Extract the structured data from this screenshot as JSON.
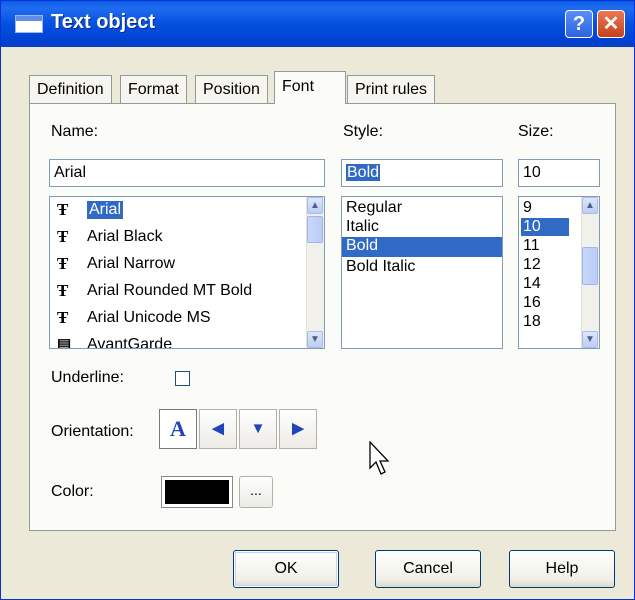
{
  "window": {
    "title": "Text object",
    "help_glyph": "?",
    "close_glyph": "✕"
  },
  "tabs": [
    {
      "label": "Definition"
    },
    {
      "label": "Format"
    },
    {
      "label": "Position"
    },
    {
      "label": "Font"
    },
    {
      "label": "Print rules"
    }
  ],
  "active_tab": "Font",
  "name": {
    "label": "Name:",
    "value": "Arial",
    "fonts": [
      {
        "label": "Arial",
        "icon": "truetype-icon",
        "selected": true
      },
      {
        "label": "Arial Black",
        "icon": "truetype-icon"
      },
      {
        "label": "Arial Narrow",
        "icon": "truetype-icon"
      },
      {
        "label": "Arial Rounded MT Bold",
        "icon": "truetype-icon"
      },
      {
        "label": "Arial Unicode MS",
        "icon": "truetype-icon"
      },
      {
        "label": "AvantGarde",
        "icon": "printer-font-icon"
      }
    ]
  },
  "style": {
    "label": "Style:",
    "value": "Bold",
    "options": [
      "Regular",
      "Italic",
      "Bold",
      "Bold Italic"
    ],
    "selected": "Bold"
  },
  "size": {
    "label": "Size:",
    "value": "10",
    "options": [
      "9",
      "10",
      "11",
      "12",
      "14",
      "16",
      "18"
    ],
    "selected": "10"
  },
  "underline": {
    "label": "Underline:",
    "checked": false
  },
  "orientation": {
    "label": "Orientation:",
    "options": [
      {
        "glyph": "A",
        "name": "orientation-normal"
      },
      {
        "glyph": "◀",
        "name": "orientation-left"
      },
      {
        "glyph": "▼",
        "name": "orientation-down"
      },
      {
        "glyph": "▶",
        "name": "orientation-right"
      }
    ],
    "selected": "orientation-normal"
  },
  "color": {
    "label": "Color:",
    "value": "#000000",
    "more_label": "..."
  },
  "buttons": {
    "ok": "OK",
    "cancel": "Cancel",
    "help": "Help"
  }
}
